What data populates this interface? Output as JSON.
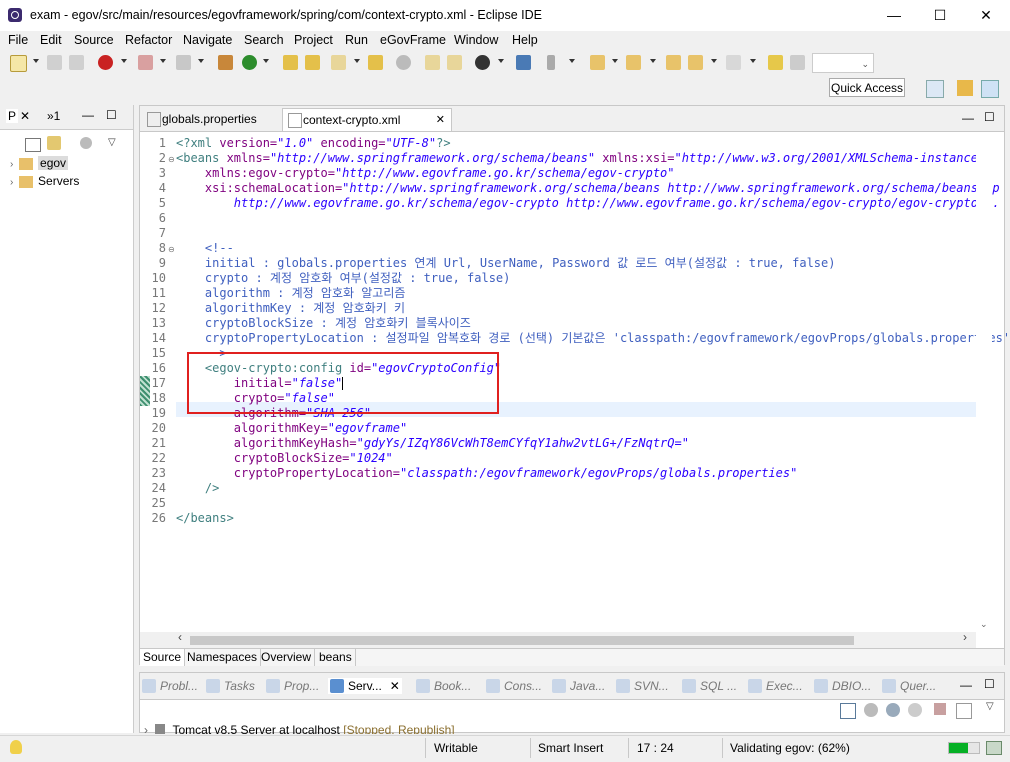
{
  "window": {
    "title": "exam - egov/src/main/resources/egovframework/spring/com/context-crypto.xml - Eclipse IDE",
    "minimize": "—",
    "maximize": "☐",
    "close": "✕"
  },
  "menu": [
    "File",
    "Edit",
    "Source",
    "Refactor",
    "Navigate",
    "Search",
    "Project",
    "Run",
    "eGovFrame",
    "Window",
    "Help"
  ],
  "toolbar": {
    "quick_access": "Quick Access"
  },
  "left_panel": {
    "tab1": "P",
    "tab2": "»1",
    "tree": [
      "egov",
      "Servers"
    ]
  },
  "editor": {
    "tabs": [
      "globals.properties",
      "context-crypto.xml"
    ],
    "active_tab": "context-crypto.xml",
    "line_numbers": [
      "1",
      "2",
      "3",
      "4",
      "5",
      "6",
      "7",
      "8",
      "9",
      "10",
      "11",
      "12",
      "13",
      "14",
      "15",
      "16",
      "17",
      "18",
      "19",
      "20",
      "21",
      "22",
      "23",
      "24",
      "25",
      "26"
    ],
    "bottom_tabs": [
      "Source",
      "Namespaces",
      "Overview",
      "beans"
    ],
    "lines": {
      "l1a": "<?xml ",
      "l1b": "version=",
      "l1c": "\"1.0\"",
      "l1d": " encoding=",
      "l1e": "\"UTF-8\"",
      "l1f": "?>",
      "l2a": "<beans ",
      "l2b": "xmlns=",
      "l2c": "\"http://www.springframework.org/schema/beans\"",
      "l2d": " xmlns:xsi=",
      "l2e": "\"http://www.w3.org/2001/XMLSchema-instance\"",
      "l3a": "    xmlns:egov-crypto=",
      "l3b": "\"http://www.egovframe.go.kr/schema/egov-crypto\"",
      "l4a": "    xsi:schemaLocation=",
      "l4b": "\"http://www.springframework.org/schema/beans http://www.springframework.org/schema/beans/sp",
      "l5": "        http://www.egovframe.go.kr/schema/egov-crypto http://www.egovframe.go.kr/schema/egov-crypto/egov-crypto-3.",
      "l8": "    <!--",
      "l9": "    initial : globals.properties 연계 Url, UserName, Password 값 로드 여부(설정값 : true, false)",
      "l10": "    crypto : 계정 암호화 여부(설정값 : true, false)",
      "l11": "    algorithm : 계정 암호화 알고리즘",
      "l12": "    algorithmKey : 계정 암호화키 키",
      "l13": "    cryptoBlockSize : 계정 암호화키 블록사이즈",
      "l14": "    cryptoPropertyLocation : 설정파일 암복호화 경로 (선택) 기본값은 'classpath:/egovframework/egovProps/globals.properties'",
      "l15": "    -->",
      "l16a": "    <egov-crypto:config ",
      "l16b": "id=",
      "l16c": "\"egovCryptoConfig\"",
      "l17a": "        initial=",
      "l17b": "\"false\"",
      "l18a": "        crypto=",
      "l18b": "\"false\"",
      "l19a": "        algorithm=",
      "l19b": "\"SHA-256\"",
      "l20a": "        algorithmKey=",
      "l20b": "\"egovframe\"",
      "l21a": "        algorithmKeyHash=",
      "l21b": "\"gdyYs/IZqY86VcWhT8emCYfqY1ahw2vtLG+/FzNqtrQ=\"",
      "l22a": "        cryptoBlockSize=",
      "l22b": "\"1024\"",
      "l23a": "        cryptoPropertyLocation=",
      "l23b": "\"classpath:/egovframework/egovProps/globals.properties\"",
      "l24": "    />",
      "l26": "</beans>"
    }
  },
  "bottom_panel": {
    "tabs": [
      "Probl...",
      "Tasks",
      "Prop...",
      "Serv...",
      "Book...",
      "Cons...",
      "Java...",
      "SVN...",
      "SQL ...",
      "Exec...",
      "DBIO...",
      "Quer..."
    ],
    "server_row": "Tomcat v8.5 Server at localhost",
    "server_status": "[Stopped, Republish]"
  },
  "status": {
    "writable": "Writable",
    "insert_mode": "Smart Insert",
    "position": "17 : 24",
    "progress_text": "Validating egov: (62%)",
    "progress_value": 62
  },
  "colors": {
    "highlight_box": "#e0201f",
    "tag": "#3f7f7f",
    "attribute": "#7f007f",
    "value": "#2a00ff",
    "comment": "#3f5fbf",
    "progress": "#06b025"
  }
}
